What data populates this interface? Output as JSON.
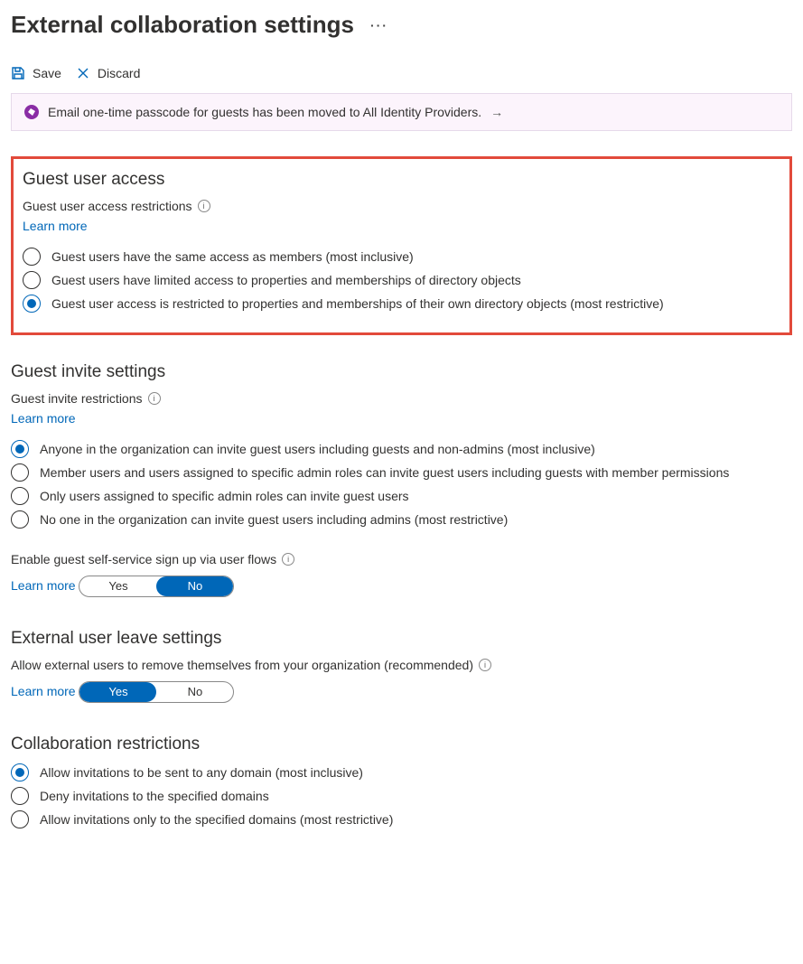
{
  "page": {
    "title": "External collaboration settings"
  },
  "commands": {
    "save": "Save",
    "discard": "Discard"
  },
  "banner": {
    "text": "Email one-time passcode for guests has been moved to All Identity Providers."
  },
  "guestAccess": {
    "heading": "Guest user access",
    "sub": "Guest user access restrictions",
    "learn": "Learn more",
    "opts": [
      "Guest users have the same access as members (most inclusive)",
      "Guest users have limited access to properties and memberships of directory objects",
      "Guest user access is restricted to properties and memberships of their own directory objects (most restrictive)"
    ],
    "selected": 2
  },
  "invite": {
    "heading": "Guest invite settings",
    "sub": "Guest invite restrictions",
    "learn": "Learn more",
    "opts": [
      "Anyone in the organization can invite guest users including guests and non-admins (most inclusive)",
      "Member users and users assigned to specific admin roles can invite guest users including guests with member permissions",
      "Only users assigned to specific admin roles can invite guest users",
      "No one in the organization can invite guest users including admins (most restrictive)"
    ],
    "selected": 0
  },
  "selfService": {
    "label": "Enable guest self-service sign up via user flows",
    "learn": "Learn more",
    "yes": "Yes",
    "no": "No",
    "value": "No"
  },
  "leave": {
    "heading": "External user leave settings",
    "label": "Allow external users to remove themselves from your organization (recommended)",
    "learn": "Learn more",
    "yes": "Yes",
    "no": "No",
    "value": "Yes"
  },
  "collab": {
    "heading": "Collaboration restrictions",
    "opts": [
      "Allow invitations to be sent to any domain (most inclusive)",
      "Deny invitations to the specified domains",
      "Allow invitations only to the specified domains (most restrictive)"
    ],
    "selected": 0
  }
}
